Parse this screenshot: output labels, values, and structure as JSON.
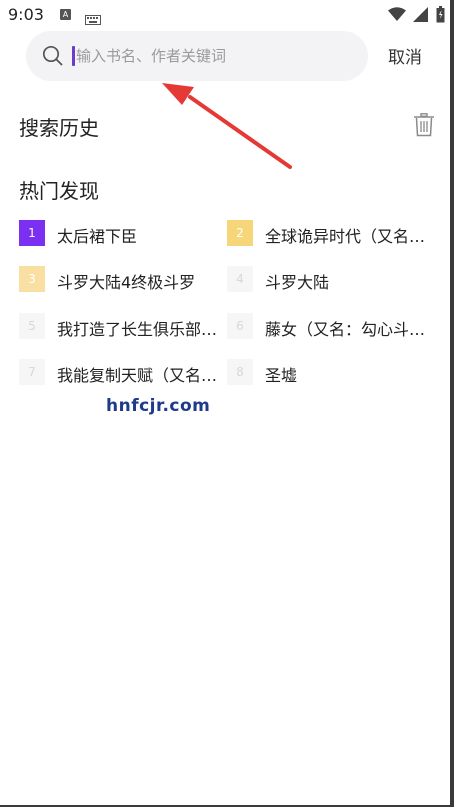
{
  "status_bar": {
    "time": "9:03",
    "icons": [
      "a-app-icon",
      "keyboard-icon",
      "wifi-icon",
      "signal-icon",
      "battery-icon"
    ]
  },
  "search": {
    "placeholder": "输入书名、作者关键词",
    "value": "",
    "cancel_label": "取消"
  },
  "history": {
    "title": "搜索历史",
    "clear_icon": "trash-icon"
  },
  "hot": {
    "title": "热门发现",
    "items": [
      {
        "rank": "1",
        "label": "太后裙下臣"
      },
      {
        "rank": "2",
        "label": "全球诡异时代（又名…"
      },
      {
        "rank": "3",
        "label": "斗罗大陆4终极斗罗"
      },
      {
        "rank": "4",
        "label": "斗罗大陆"
      },
      {
        "rank": "5",
        "label": "我打造了长生俱乐部…"
      },
      {
        "rank": "6",
        "label": "藤女（又名：勾心斗…"
      },
      {
        "rank": "7",
        "label": "我能复制天赋（又名…"
      },
      {
        "rank": "8",
        "label": "圣墟"
      }
    ],
    "rank_colors": {
      "1": "#7b2ff0",
      "2": "#f7d679",
      "3": "#f9dfa2",
      "other": "#f6f6f6"
    }
  },
  "watermark": "hnfcjr.com",
  "accent_colors": {
    "caret": "#6a3ad1",
    "arrow": "#e53935"
  }
}
